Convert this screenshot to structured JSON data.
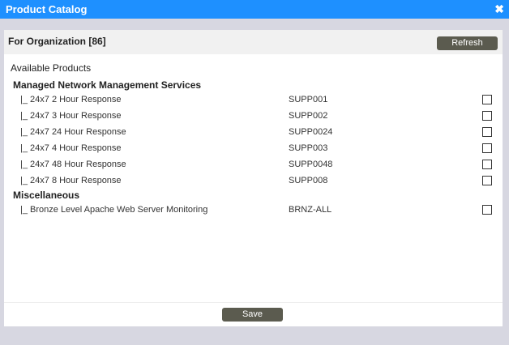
{
  "window": {
    "title": "Product Catalog",
    "close_glyph": "✖"
  },
  "org": {
    "title": "For Organization [86]",
    "refresh_label": "Refresh"
  },
  "section": {
    "title": "Available Products"
  },
  "groups": [
    {
      "title": "Managed Network Management Services",
      "items": [
        {
          "name": "|_ 24x7 2 Hour Response",
          "code": "SUPP001",
          "checked": false
        },
        {
          "name": "|_ 24x7 3 Hour Response",
          "code": "SUPP002",
          "checked": false
        },
        {
          "name": "|_ 24x7 24 Hour Response",
          "code": "SUPP0024",
          "checked": false
        },
        {
          "name": "|_ 24x7 4 Hour Response",
          "code": "SUPP003",
          "checked": false
        },
        {
          "name": "|_ 24x7 48 Hour Response",
          "code": "SUPP0048",
          "checked": false
        },
        {
          "name": "|_ 24x7 8 Hour Response",
          "code": "SUPP008",
          "checked": false
        }
      ]
    },
    {
      "title": "Miscellaneous",
      "items": [
        {
          "name": "|_ Bronze Level Apache Web Server Monitoring",
          "code": "BRNZ-ALL",
          "checked": false
        }
      ]
    }
  ],
  "footer": {
    "save_label": "Save"
  },
  "colors": {
    "titlebar": "#1e90ff",
    "button": "#5b5b4f",
    "background": "#d7d7e1"
  }
}
